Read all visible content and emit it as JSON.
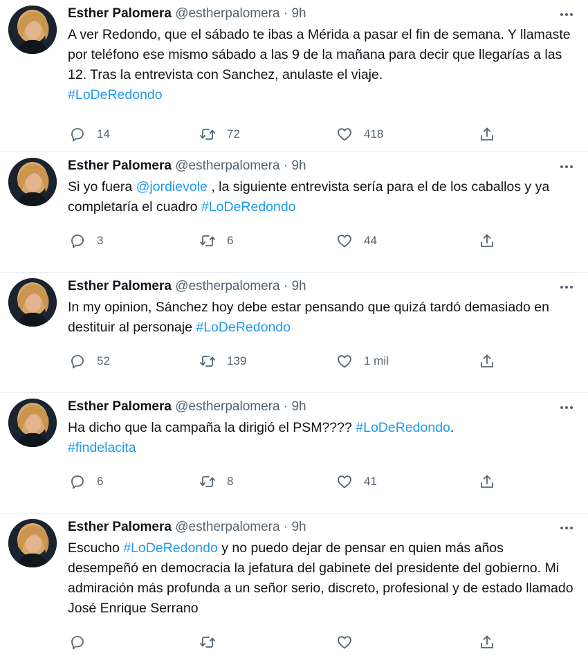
{
  "author": {
    "name": "Esther Palomera",
    "handle": "@estherpalomera",
    "separator": "·"
  },
  "tweets": [
    {
      "time": "9h",
      "text_parts": [
        {
          "t": "A ver Redondo, que el sábado te ibas a Mérida a pasar el fin de semana. Y llamaste por teléfono ese mismo sábado a las 9 de la mañana para decir que llegarías a las 12. Tras la entrevista con Sanchez, anulaste el viaje.\n",
          "link": false
        },
        {
          "t": "#LoDeRedondo",
          "link": true
        }
      ],
      "replies": "14",
      "retweets": "72",
      "likes": "418"
    },
    {
      "time": "9h",
      "text_parts": [
        {
          "t": "Si yo fuera ",
          "link": false
        },
        {
          "t": "@jordievole",
          "link": true
        },
        {
          "t": " , la siguiente entrevista sería para el de los caballos y ya completaría el cuadro ",
          "link": false
        },
        {
          "t": "#LoDeRedondo",
          "link": true
        }
      ],
      "replies": "3",
      "retweets": "6",
      "likes": "44"
    },
    {
      "time": "9h",
      "text_parts": [
        {
          "t": "In my opinion, Sánchez hoy debe estar pensando que quizá tardó demasiado en destituir al personaje ",
          "link": false
        },
        {
          "t": "#LoDeRedondo",
          "link": true
        }
      ],
      "replies": "52",
      "retweets": "139",
      "likes": "1 mil"
    },
    {
      "time": "9h",
      "text_parts": [
        {
          "t": "Ha dicho que la campaña la dirigió el PSM???? ",
          "link": false
        },
        {
          "t": "#LoDeRedondo",
          "link": true
        },
        {
          "t": ".\n",
          "link": false
        },
        {
          "t": "#findelacita",
          "link": true
        }
      ],
      "replies": "6",
      "retweets": "8",
      "likes": "41"
    },
    {
      "time": "9h",
      "text_parts": [
        {
          "t": "Escucho ",
          "link": false
        },
        {
          "t": "#LoDeRedondo",
          "link": true
        },
        {
          "t": " y no puedo dejar de pensar en quien más años desempeñó en democracia la jefatura del gabinete del presidente del gobierno. Mi admiración más profunda a un señor serio, discreto, profesional y de estado llamado José Enrique Serrano",
          "link": false
        }
      ],
      "replies": "",
      "retweets": "",
      "likes": ""
    }
  ],
  "colors": {
    "link": "#1d9bf0",
    "muted": "#536471",
    "divider": "#e6ecf0"
  },
  "icons": [
    "reply-icon",
    "retweet-icon",
    "like-icon",
    "share-icon",
    "more-icon"
  ]
}
